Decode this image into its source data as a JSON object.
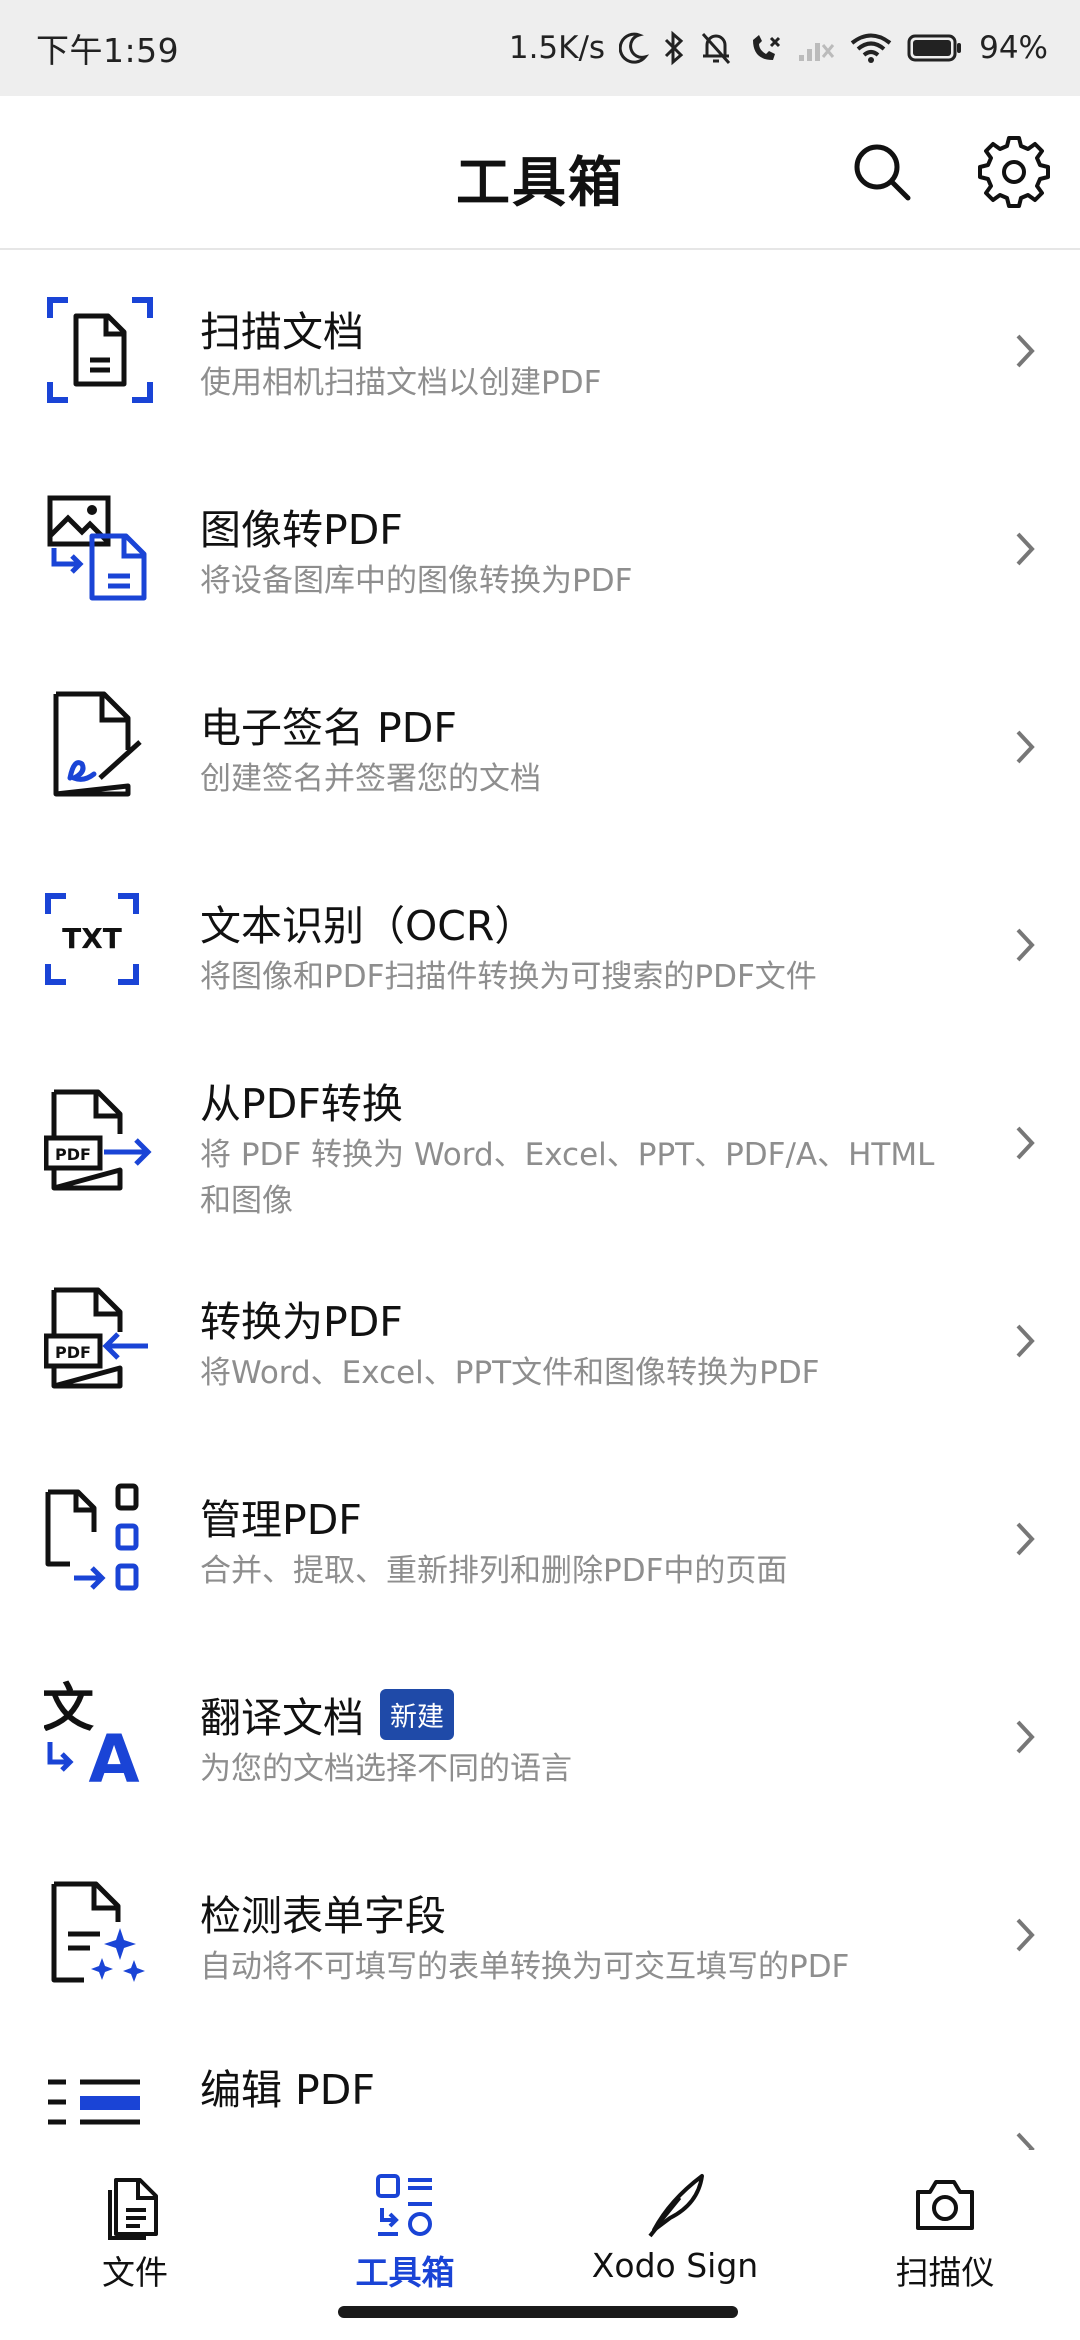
{
  "status_bar": {
    "time": "下午1:59",
    "net_speed": "1.5K/s",
    "battery": "94%"
  },
  "app_bar": {
    "title": "工具箱",
    "search_icon": "search-icon",
    "settings_icon": "gear-icon"
  },
  "tools": [
    {
      "title": "扫描文档",
      "subtitle": "使用相机扫描文档以创建PDF",
      "icon": "scan-document-icon"
    },
    {
      "title": "图像转PDF",
      "subtitle": "将设备图库中的图像转换为PDF",
      "icon": "image-to-pdf-icon"
    },
    {
      "title": "电子签名 PDF",
      "subtitle": "创建签名并签署您的文档",
      "icon": "esign-icon"
    },
    {
      "title": "文本识别（OCR）",
      "subtitle": "将图像和PDF扫描件转换为可搜索的PDF文件",
      "icon": "ocr-icon"
    },
    {
      "title": "从PDF转换",
      "subtitle": "将 PDF 转换为 Word、Excel、PPT、PDF/A、HTML 和图像",
      "icon": "convert-from-pdf-icon"
    },
    {
      "title": "转换为PDF",
      "subtitle": "将Word、Excel、PPT文件和图像转换为PDF",
      "icon": "convert-to-pdf-icon"
    },
    {
      "title": "管理PDF",
      "subtitle": "合并、提取、重新排列和删除PDF中的页面",
      "icon": "manage-pages-icon"
    },
    {
      "title": "翻译文档",
      "badge": "新建",
      "subtitle": "为您的文档选择不同的语言",
      "icon": "translate-icon"
    },
    {
      "title": "检测表单字段",
      "subtitle": "自动将不可填写的表单转换为可交互填写的PDF",
      "icon": "form-detect-icon"
    },
    {
      "title": "编辑 PDF",
      "subtitle": "",
      "icon": "edit-pdf-icon"
    }
  ],
  "bottom_nav": [
    {
      "label": "文件",
      "icon": "file-icon",
      "active": false
    },
    {
      "label": "工具箱",
      "icon": "toolbox-icon",
      "active": true
    },
    {
      "label": "Xodo Sign",
      "icon": "quill-icon",
      "active": false
    },
    {
      "label": "扫描仪",
      "icon": "camera-icon",
      "active": false
    }
  ],
  "colors": {
    "accent": "#1a44d6",
    "badge": "#1f4aa8",
    "subtitle": "#8e8e8e"
  }
}
